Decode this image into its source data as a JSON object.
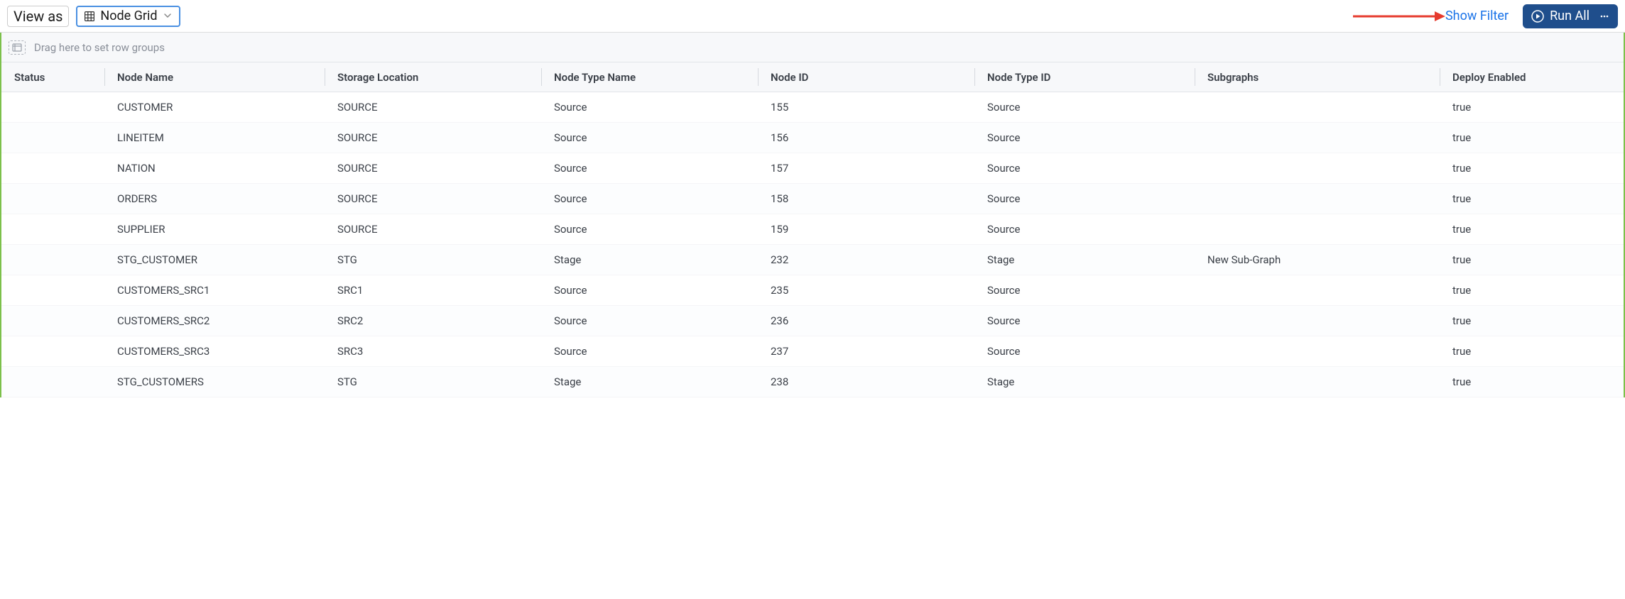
{
  "toolbar": {
    "view_as_label": "View as",
    "view_select_value": "Node Grid",
    "show_filter_label": "Show Filter",
    "run_all_label": "Run All"
  },
  "group_bar": {
    "placeholder": "Drag here to set row groups"
  },
  "columns": {
    "status": "Status",
    "node_name": "Node Name",
    "storage_location": "Storage Location",
    "node_type_name": "Node Type Name",
    "node_id": "Node ID",
    "node_type_id": "Node Type ID",
    "subgraphs": "Subgraphs",
    "deploy_enabled": "Deploy Enabled"
  },
  "rows": [
    {
      "status": "",
      "node_name": "CUSTOMER",
      "storage_location": "SOURCE",
      "node_type_name": "Source",
      "node_id": "155",
      "node_type_id": "Source",
      "subgraphs": "",
      "deploy_enabled": "true"
    },
    {
      "status": "",
      "node_name": "LINEITEM",
      "storage_location": "SOURCE",
      "node_type_name": "Source",
      "node_id": "156",
      "node_type_id": "Source",
      "subgraphs": "",
      "deploy_enabled": "true"
    },
    {
      "status": "",
      "node_name": "NATION",
      "storage_location": "SOURCE",
      "node_type_name": "Source",
      "node_id": "157",
      "node_type_id": "Source",
      "subgraphs": "",
      "deploy_enabled": "true"
    },
    {
      "status": "",
      "node_name": "ORDERS",
      "storage_location": "SOURCE",
      "node_type_name": "Source",
      "node_id": "158",
      "node_type_id": "Source",
      "subgraphs": "",
      "deploy_enabled": "true"
    },
    {
      "status": "",
      "node_name": "SUPPLIER",
      "storage_location": "SOURCE",
      "node_type_name": "Source",
      "node_id": "159",
      "node_type_id": "Source",
      "subgraphs": "",
      "deploy_enabled": "true"
    },
    {
      "status": "",
      "node_name": "STG_CUSTOMER",
      "storage_location": "STG",
      "node_type_name": "Stage",
      "node_id": "232",
      "node_type_id": "Stage",
      "subgraphs": "New Sub-Graph",
      "deploy_enabled": "true"
    },
    {
      "status": "",
      "node_name": "CUSTOMERS_SRC1",
      "storage_location": "SRC1",
      "node_type_name": "Source",
      "node_id": "235",
      "node_type_id": "Source",
      "subgraphs": "",
      "deploy_enabled": "true"
    },
    {
      "status": "",
      "node_name": "CUSTOMERS_SRC2",
      "storage_location": "SRC2",
      "node_type_name": "Source",
      "node_id": "236",
      "node_type_id": "Source",
      "subgraphs": "",
      "deploy_enabled": "true"
    },
    {
      "status": "",
      "node_name": "CUSTOMERS_SRC3",
      "storage_location": "SRC3",
      "node_type_name": "Source",
      "node_id": "237",
      "node_type_id": "Source",
      "subgraphs": "",
      "deploy_enabled": "true"
    },
    {
      "status": "",
      "node_name": "STG_CUSTOMERS",
      "storage_location": "STG",
      "node_type_name": "Stage",
      "node_id": "238",
      "node_type_id": "Stage",
      "subgraphs": "",
      "deploy_enabled": "true"
    }
  ]
}
